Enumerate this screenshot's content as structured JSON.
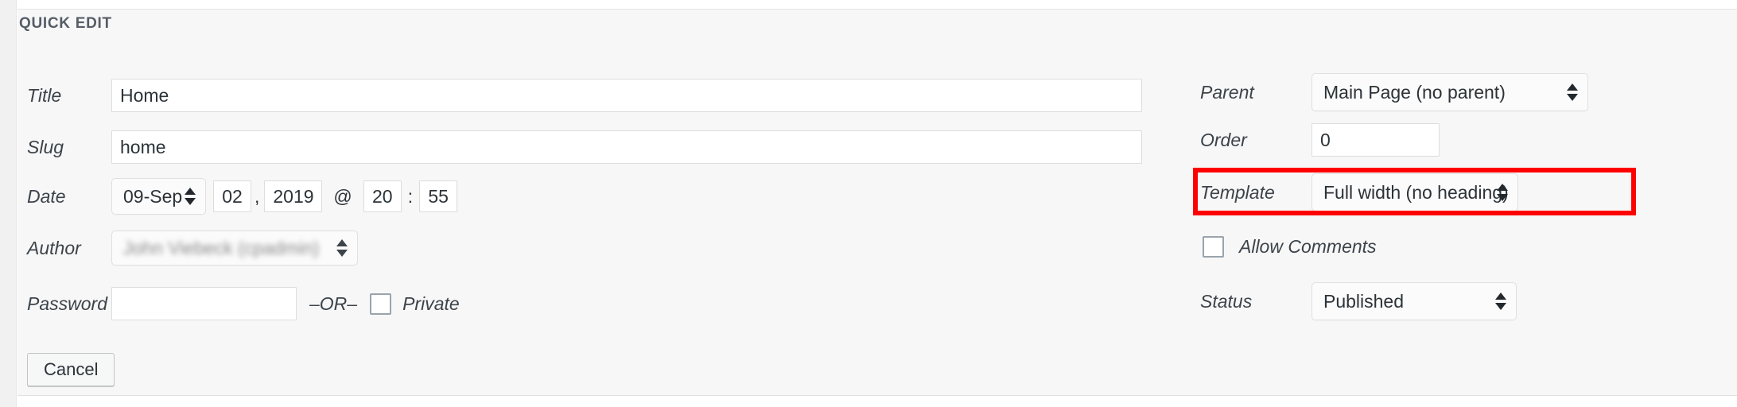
{
  "panel": {
    "legend": "QUICK EDIT"
  },
  "left_column": {
    "title": {
      "label": "Title",
      "value": "Home",
      "placeholder": ""
    },
    "slug": {
      "label": "Slug",
      "value": "home",
      "placeholder": ""
    },
    "date": {
      "label": "Date",
      "month_value": "09-Sep",
      "day_value": "02",
      "comma": ",",
      "year_value": "2019",
      "at_symbol": "@",
      "hour_value": "20",
      "colon": ":",
      "minute_value": "55"
    },
    "author": {
      "label": "Author",
      "value": "John Viebeck (cpadmin)"
    },
    "password": {
      "label": "Password",
      "value": "",
      "placeholder": "",
      "or_text": "–OR–",
      "private_label": "Private",
      "private_checked": false
    },
    "cancel_label": "Cancel"
  },
  "right_column": {
    "parent": {
      "label": "Parent",
      "value": "Main Page (no parent)"
    },
    "order": {
      "label": "Order",
      "value": "0"
    },
    "template": {
      "label": "Template",
      "value": "Full width (no heading)",
      "highlighted": true,
      "highlight_color": "#ff0000"
    },
    "comments": {
      "label": "Allow Comments",
      "checked": false
    },
    "status": {
      "label": "Status",
      "value": "Published"
    }
  },
  "icons": {
    "spinner": "updown-arrows-icon"
  }
}
